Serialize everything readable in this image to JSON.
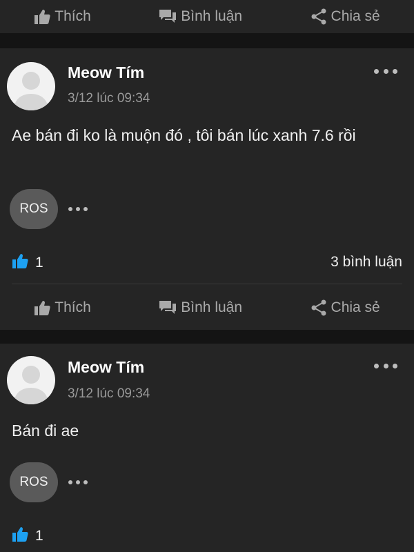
{
  "actions": {
    "like_label": "Thích",
    "comment_label": "Bình luận",
    "share_label": "Chia sẻ"
  },
  "posts": [
    {
      "author": "Meow Tím",
      "timestamp": "3/12 lúc 09:34",
      "text": "Ae bán đi ko là muộn đó , tôi bán lúc xanh 7.6 rồi",
      "tag": "ROS",
      "like_count": "1",
      "comment_count": "3 bình luận"
    },
    {
      "author": "Meow Tím",
      "timestamp": "3/12 lúc 09:34",
      "text": "Bán đi ae",
      "tag": "ROS",
      "like_count": "1"
    }
  ],
  "colors": {
    "background": "#141414",
    "card": "#252525",
    "like_blue": "#1da1f2",
    "muted": "#a9a9a9"
  },
  "icons": [
    "thumbs-up-icon",
    "comment-icon",
    "share-icon",
    "more-icon"
  ]
}
